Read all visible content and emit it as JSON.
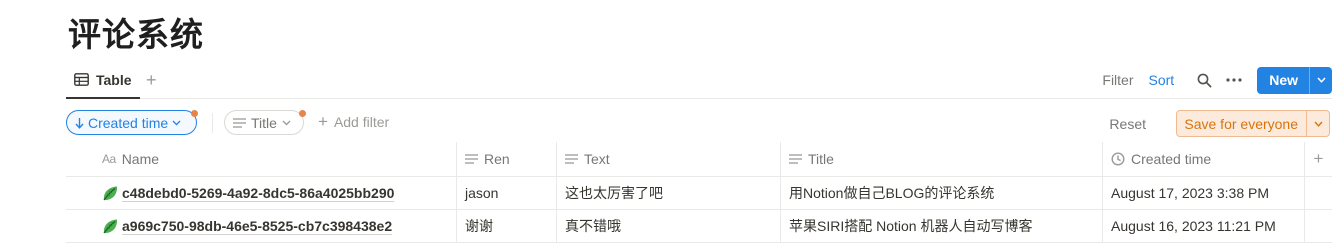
{
  "page": {
    "title": "评论系统"
  },
  "views": {
    "tabs": [
      {
        "label": "Table",
        "icon": "table-icon"
      }
    ],
    "add_icon": "plus-icon"
  },
  "toolbar": {
    "filter_label": "Filter",
    "sort_label": "Sort",
    "search_icon": "search-icon",
    "more_icon": "more-horizontal-icon",
    "new_label": "New"
  },
  "filters": {
    "sort_pill": "Created time",
    "title_pill": "Title",
    "add_filter": "Add filter",
    "reset_label": "Reset",
    "save_label": "Save for everyone"
  },
  "table": {
    "columns": [
      {
        "label": "Name",
        "icon": "text-aa-icon"
      },
      {
        "label": "Ren",
        "icon": "text-lines-icon"
      },
      {
        "label": "Text",
        "icon": "text-lines-icon"
      },
      {
        "label": "Title",
        "icon": "text-lines-icon"
      },
      {
        "label": "Created time",
        "icon": "clock-icon"
      }
    ],
    "rows": [
      {
        "name": "c48debd0-5269-4a92-8dc5-86a4025bb290",
        "ren": "jason",
        "text": "这也太厉害了吧",
        "title": "用Notion做自己BLOG的评论系统",
        "created": "August 17, 2023 3:38 PM"
      },
      {
        "name": "a969c750-98db-46e5-8525-cb7c398438e2",
        "ren": "谢谢",
        "text": "真不错哦",
        "title": "苹果SIRI搭配 Notion 机器人自动写博客",
        "created": "August 16, 2023 11:21 PM"
      }
    ]
  },
  "colors": {
    "accent": "#2383e2",
    "warning": "#d9730d",
    "dot": "#e8844a"
  }
}
